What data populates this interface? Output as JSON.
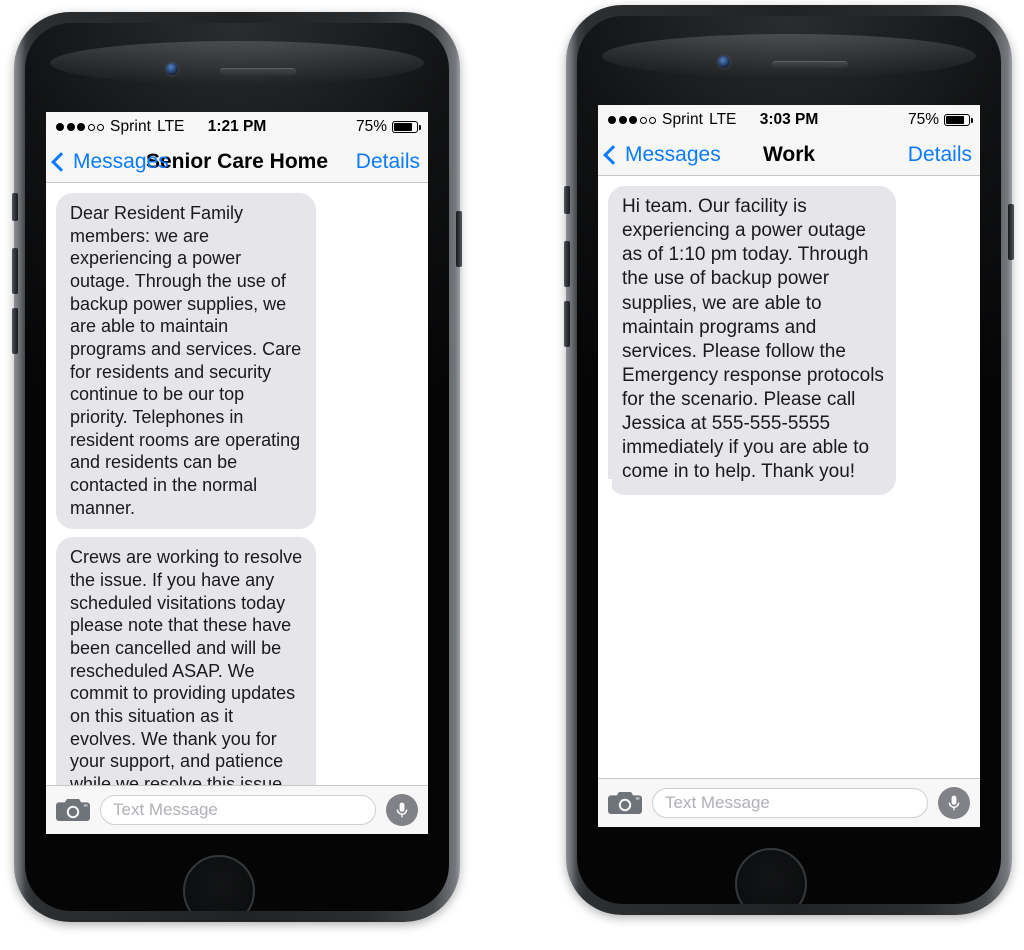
{
  "phones": [
    {
      "id": "phone-left",
      "status_bar": {
        "signal_dots_filled": 3,
        "signal_dots_hollow": 2,
        "carrier": "Sprint",
        "network": "LTE",
        "time": "1:21 PM",
        "battery_percent": "75%",
        "battery_level": 75
      },
      "nav_bar": {
        "back_label": "Messages",
        "title": "Senior Care Home",
        "details_label": "Details"
      },
      "messages": [
        "Dear Resident Family members: we are experiencing a power outage. Through the use of backup power supplies, we are able to maintain programs and services. Care for residents and security continue to be our top priority. Telephones in resident rooms are operating and residents can be contacted in the normal manner.",
        "Crews are working to resolve the issue. If you have any scheduled visitations today please note that these have been cancelled and will be rescheduled ASAP. We commit to providing updates on this situation as it evolves. We thank you for your support, and patience while we resolve this issue."
      ],
      "composer": {
        "placeholder": "Text Message",
        "value": "",
        "camera_icon": "camera-icon",
        "mic_icon": "microphone-icon"
      }
    },
    {
      "id": "phone-right",
      "status_bar": {
        "signal_dots_filled": 3,
        "signal_dots_hollow": 2,
        "carrier": "Sprint",
        "network": "LTE",
        "time": "3:03 PM",
        "battery_percent": "75%",
        "battery_level": 75
      },
      "nav_bar": {
        "back_label": "Messages",
        "title": "Work",
        "details_label": "Details"
      },
      "messages": [
        "Hi team. Our facility is experiencing a power outage as of 1:10 pm today. Through the use of backup power supplies, we are able to maintain programs and services. Please follow the Emergency response protocols for the scenario. Please call Jessica at 555-555-5555 immediately if you are able to come in to help. Thank you!"
      ],
      "composer": {
        "placeholder": "Text Message",
        "value": "",
        "camera_icon": "camera-icon",
        "mic_icon": "microphone-icon"
      }
    }
  ],
  "colors": {
    "accent_blue": "#0b7bfd",
    "bubble_gray": "#e5e5ea",
    "chrome_gray": "#f7f7f7",
    "hairline": "#c8c7cc",
    "screen_white": "#ffffff",
    "mic_button": "#808288",
    "camera_icon": "#6f737a"
  }
}
